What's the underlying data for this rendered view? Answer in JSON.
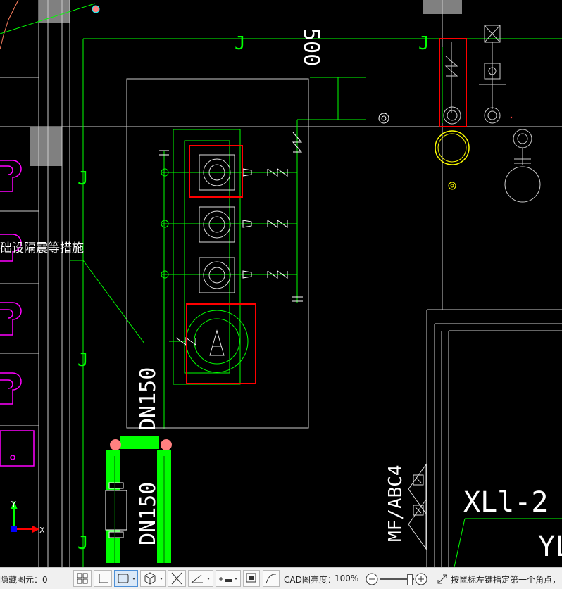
{
  "drawing": {
    "label_j": "J",
    "dim_500": "500",
    "note_text": "础设隔震等措施",
    "dn_upper": "DN150",
    "dn_lower": "DN150",
    "extinguisher": "MF/ABC4",
    "panel_main": "XLl-2",
    "panel_partial": "YL",
    "ucs_y": "Y",
    "ucs_x": "X"
  },
  "colors": {
    "background": "#000000",
    "pipe_green": "#00ff00",
    "magenta": "#ff00ff",
    "highlight_red": "#ff0000",
    "cyan": "#00ffff",
    "yellow": "#ffff00"
  },
  "statusbar": {
    "hidden_elements_label": "隐藏图元：0",
    "cad_brightness_label": "CAD图亮度：",
    "brightness_value": "100%",
    "hint": "按鼠标左键指定第一个角点，"
  },
  "icons": [
    "grid-icon",
    "axis-icon",
    "rectangle-select-icon",
    "cube-view-icon",
    "cross-icon",
    "angle-icon",
    "insert-icon",
    "screen-icon",
    "curve-icon",
    "zoom-out-icon",
    "zoom-in-icon",
    "resize-icon"
  ]
}
